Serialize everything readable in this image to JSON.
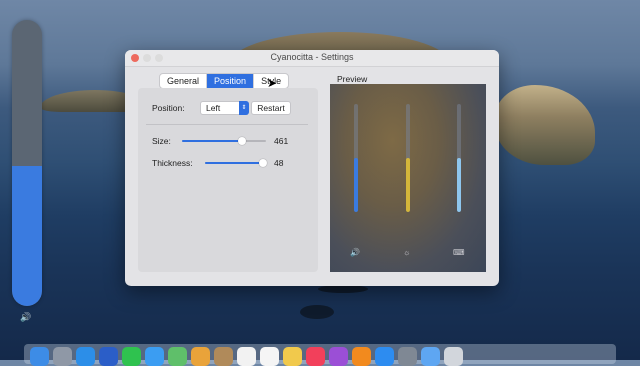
{
  "window": {
    "title": "Cyanocitta - Settings"
  },
  "tabs": [
    {
      "label": "General",
      "active": false
    },
    {
      "label": "Position",
      "active": true
    },
    {
      "label": "Style",
      "active": false
    }
  ],
  "position": {
    "label": "Position:",
    "selected": "Left",
    "restart_label": "Restart"
  },
  "size": {
    "label": "Size:",
    "value": "461",
    "fraction": 0.72
  },
  "thickness": {
    "label": "Thickness:",
    "value": "48",
    "fraction": 0.95
  },
  "preview": {
    "label": "Preview",
    "bars": [
      {
        "name": "volume",
        "level": 0.5,
        "color": "#3a7be0",
        "icon": "speaker-icon",
        "glyph": "🔊"
      },
      {
        "name": "brightness",
        "level": 0.5,
        "color": "#d4b63a",
        "icon": "sun-icon",
        "glyph": "☼"
      },
      {
        "name": "keyboard-backlight",
        "level": 0.5,
        "color": "#8ec6ee",
        "icon": "keyboard-light-icon",
        "glyph": "⌨"
      }
    ]
  },
  "hud": {
    "level": 0.49,
    "color": "#3a7be0",
    "icon": "speaker-icon",
    "glyph": "🔊"
  },
  "accent_color": "#2f6fe0",
  "dock": {
    "apps": [
      {
        "icon": "finder-icon",
        "color": "#3d8ce6"
      },
      {
        "icon": "launchpad-icon",
        "color": "#8f98a6"
      },
      {
        "icon": "safari-icon",
        "color": "#2c8ee8"
      },
      {
        "icon": "xcode-icon",
        "color": "#2b5ec8"
      },
      {
        "icon": "facetime-icon",
        "color": "#2fc24f"
      },
      {
        "icon": "mail-icon",
        "color": "#3b9df2"
      },
      {
        "icon": "maps-icon",
        "color": "#5fbf6a"
      },
      {
        "icon": "photos-icon",
        "color": "#e9a33a"
      },
      {
        "icon": "contacts-icon",
        "color": "#b08a5a"
      },
      {
        "icon": "calendar-icon",
        "color": "#f2f2f2"
      },
      {
        "icon": "reminders-icon",
        "color": "#f5f5f5"
      },
      {
        "icon": "notes-icon",
        "color": "#f1c94c"
      },
      {
        "icon": "music-icon",
        "color": "#f2405b"
      },
      {
        "icon": "podcasts-icon",
        "color": "#9b4fd6"
      },
      {
        "icon": "books-icon",
        "color": "#f28a1e"
      },
      {
        "icon": "appstore-icon",
        "color": "#2d8cf0"
      },
      {
        "icon": "system-preferences-icon",
        "color": "#7f8894"
      },
      {
        "icon": "folder-icon",
        "color": "#5ea6f2"
      },
      {
        "icon": "trash-icon",
        "color": "#d2d6dc"
      }
    ]
  }
}
